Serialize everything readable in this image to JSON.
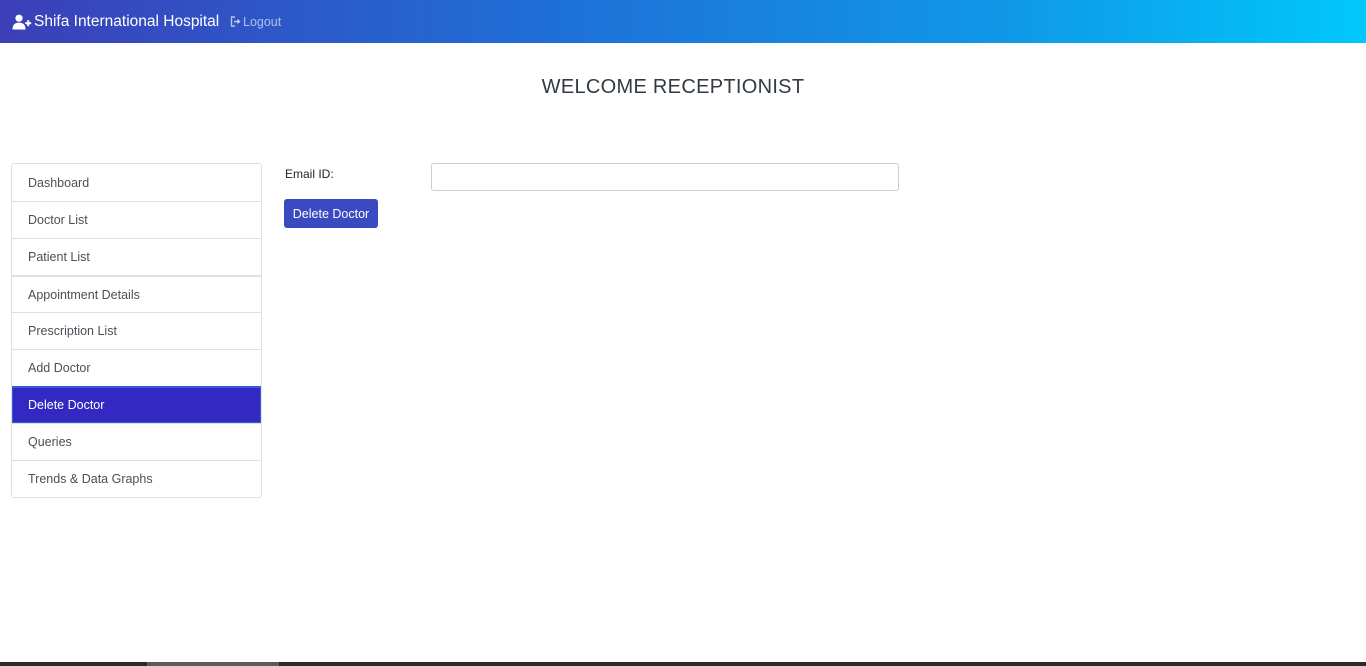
{
  "navbar": {
    "brand_icon": "user-plus-icon",
    "brand": "Shifa International Hospital",
    "logout_icon": "sign-out-icon",
    "logout": "Logout"
  },
  "page": {
    "title": "WELCOME RECEPTIONIST"
  },
  "sidebar": {
    "items": [
      {
        "label": "Dashboard",
        "active": false
      },
      {
        "label": "Doctor List",
        "active": false
      },
      {
        "label": "Patient List",
        "active": false
      },
      {
        "label": "Appointment Details",
        "active": false
      },
      {
        "label": "Prescription List",
        "active": false
      },
      {
        "label": "Add Doctor",
        "active": false
      },
      {
        "label": "Delete Doctor",
        "active": true
      },
      {
        "label": "Queries",
        "active": false
      },
      {
        "label": "Trends & Data Graphs",
        "active": false
      }
    ]
  },
  "form": {
    "email_label": "Email ID:",
    "email_value": "",
    "email_placeholder": "",
    "submit_label": "Delete Doctor"
  },
  "colors": {
    "navbar_gradient_start": "#3c3fb8",
    "navbar_gradient_end": "#00c8fb",
    "active_item": "#3328c2",
    "button": "#3a4bc2"
  }
}
